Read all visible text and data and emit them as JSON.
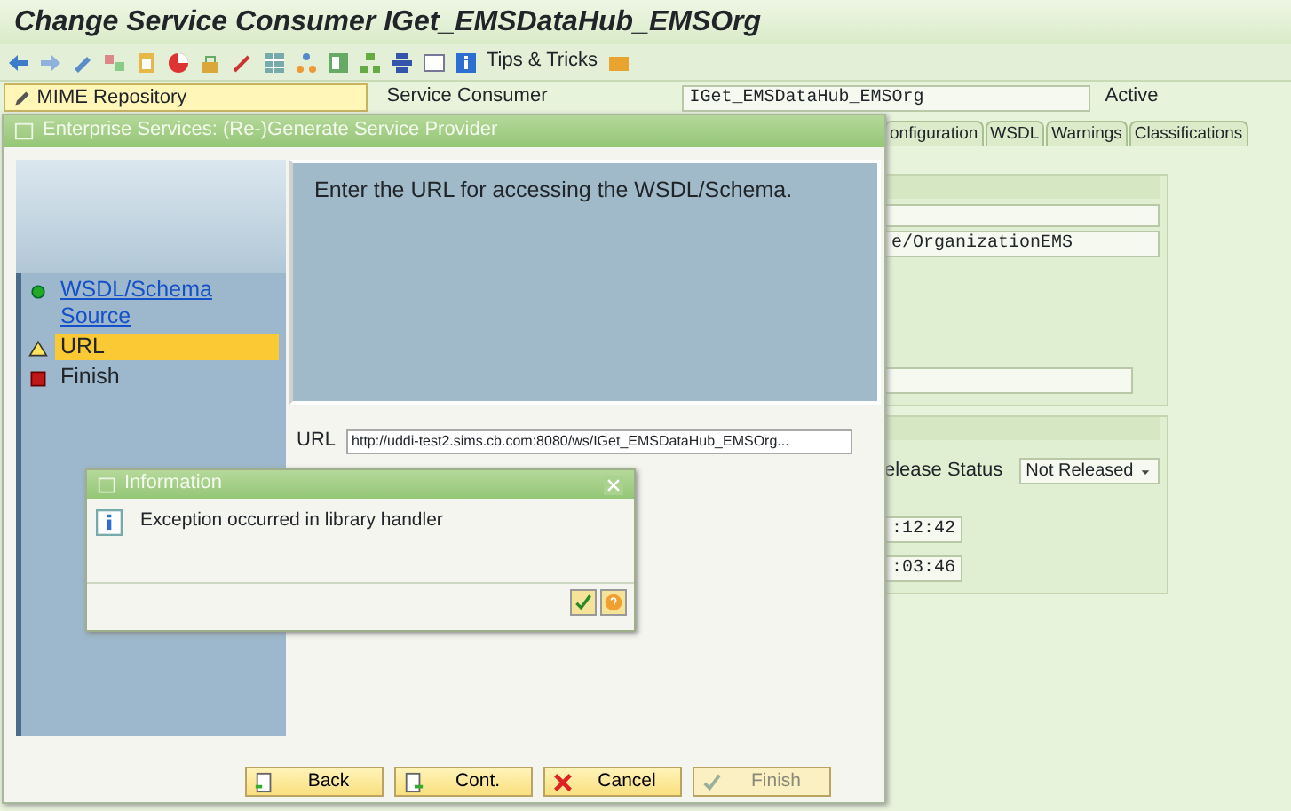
{
  "window": {
    "title": "Change Service Consumer IGet_EMSDataHub_EMSOrg"
  },
  "toolbar": {
    "tips_label": "Tips & Tricks"
  },
  "left_panel": {
    "field_value": "MIME Repository"
  },
  "header": {
    "label": "Service Consumer",
    "value": "IGet_EMSDataHub_EMSOrg",
    "status": "Active"
  },
  "tabs": [
    {
      "label": "onfiguration",
      "selected": false
    },
    {
      "label": "WSDL",
      "selected": false
    },
    {
      "label": "Warnings",
      "selected": false
    },
    {
      "label": "Classifications",
      "selected": false
    }
  ],
  "details": {
    "field_2": "e/OrganizationEMS",
    "release_label": "elease Status",
    "release_value": "Not Released",
    "time_1": ":12:42",
    "time_2": ":03:46"
  },
  "wizard": {
    "title": "Enterprise Services: (Re-)Generate Service Provider",
    "steps": [
      {
        "label": "WSDL/Schema Source",
        "kind": "done",
        "selected": false
      },
      {
        "label": "URL",
        "kind": "current",
        "selected": true
      },
      {
        "label": "Finish",
        "kind": "pending",
        "selected": false
      }
    ],
    "instruction": "Enter the URL for accessing the WSDL/Schema.",
    "url_label": "URL",
    "url_value": "http://uddi-test2.sims.cb.com:8080/ws/IGet_EMSDataHub_EMSOrg...",
    "buttons": [
      {
        "label": "Back",
        "kind": "back",
        "disabled": false
      },
      {
        "label": "Cont.",
        "kind": "continue",
        "disabled": false
      },
      {
        "label": "Cancel",
        "kind": "cancel",
        "disabled": false
      },
      {
        "label": "Finish",
        "kind": "finish",
        "disabled": true
      }
    ]
  },
  "popup": {
    "title": "Information",
    "message": "Exception occurred in library handler"
  }
}
